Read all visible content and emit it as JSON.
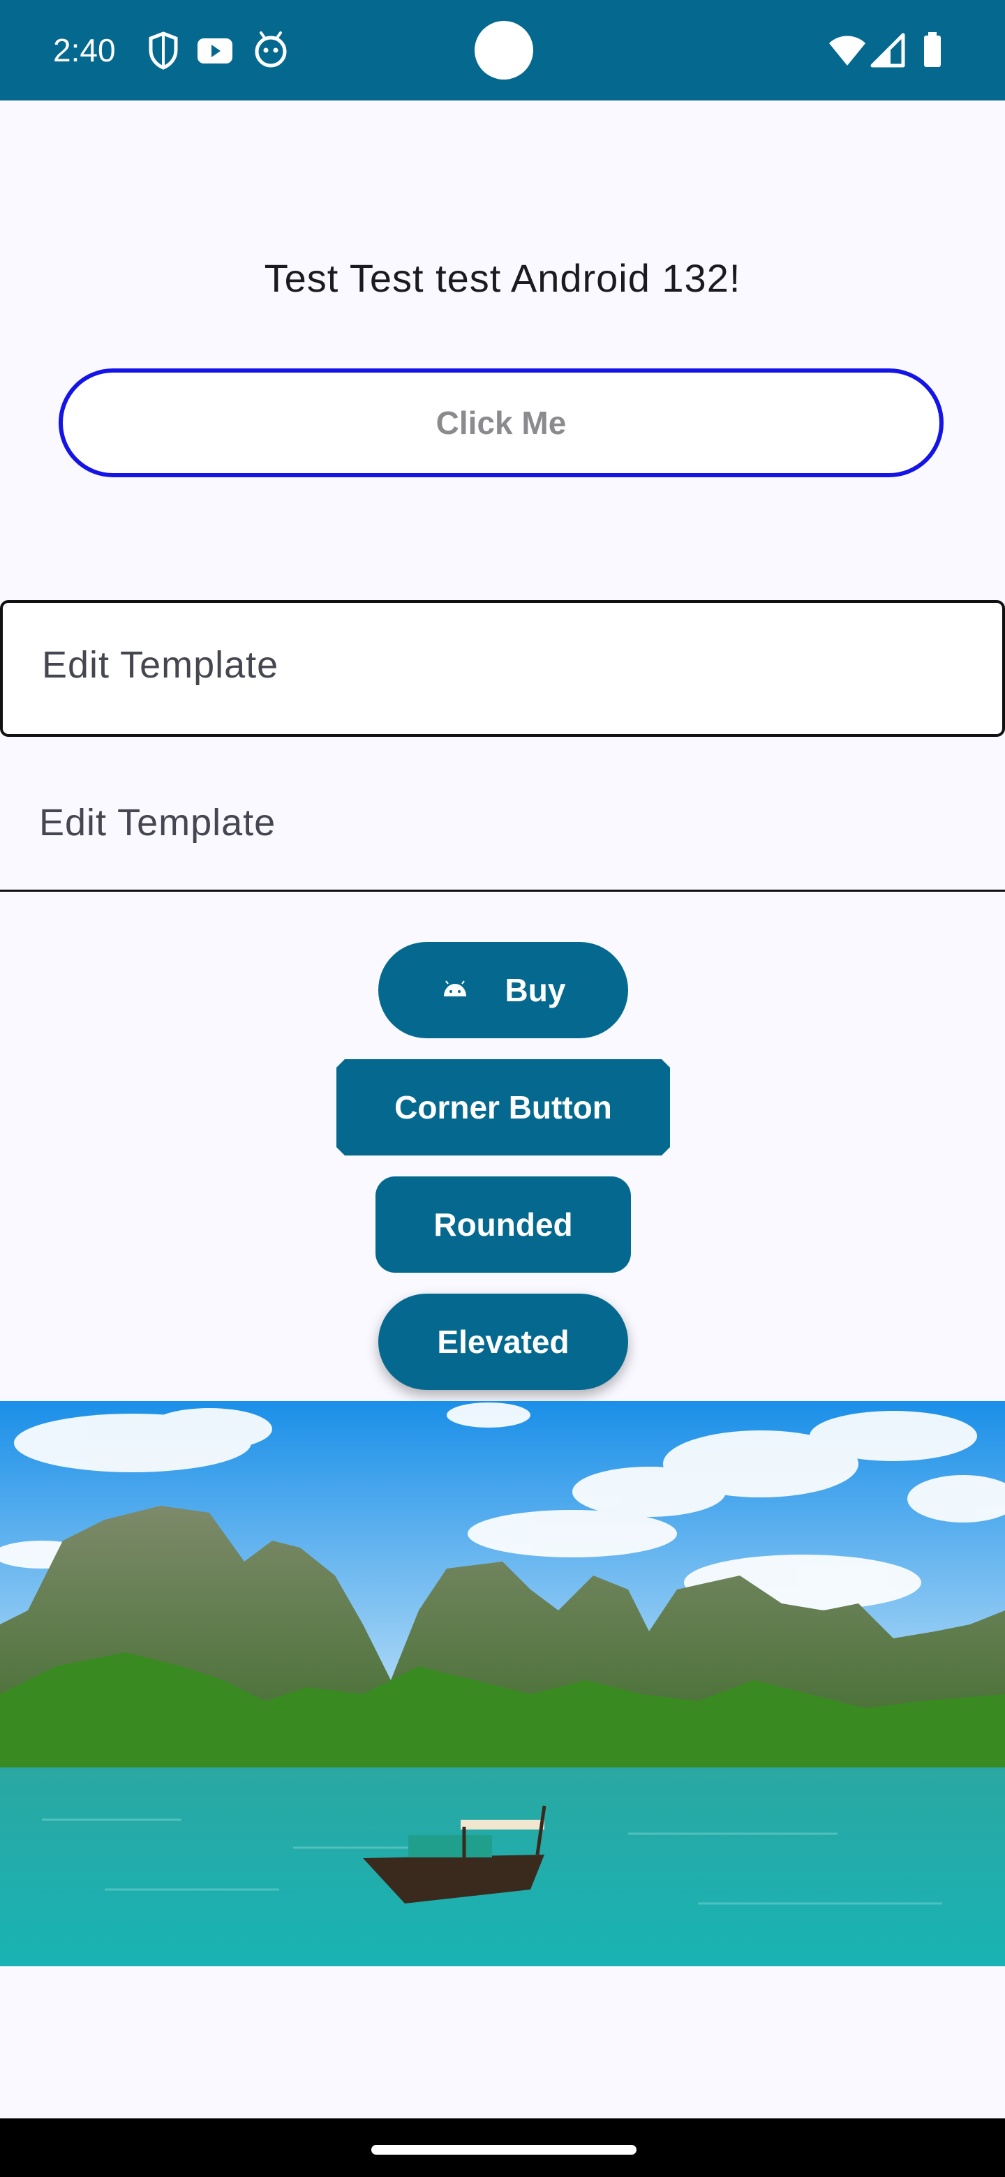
{
  "status_bar": {
    "time": "2:40",
    "left_icons": [
      "shield-icon",
      "youtube-icon",
      "android-debug-icon"
    ],
    "right_icons": [
      "wifi-icon",
      "cell-signal-icon",
      "battery-icon"
    ],
    "background": "#05698f"
  },
  "main": {
    "greeting": "Test Test test Android 132!",
    "click_button_label": "Click Me",
    "outlined_field": {
      "value": "Edit Template"
    },
    "underlined_field": {
      "value": "Edit Template"
    },
    "buttons": {
      "buy_label": "Buy",
      "buy_icon": "android-icon",
      "corner_label": "Corner Button",
      "rounded_label": "Rounded",
      "elevated_label": "Elevated"
    },
    "image": {
      "subject": "landscape-photo"
    }
  },
  "colors": {
    "primary": "#05698f",
    "click_border": "#1414e6",
    "background": "#f9f9ff"
  }
}
